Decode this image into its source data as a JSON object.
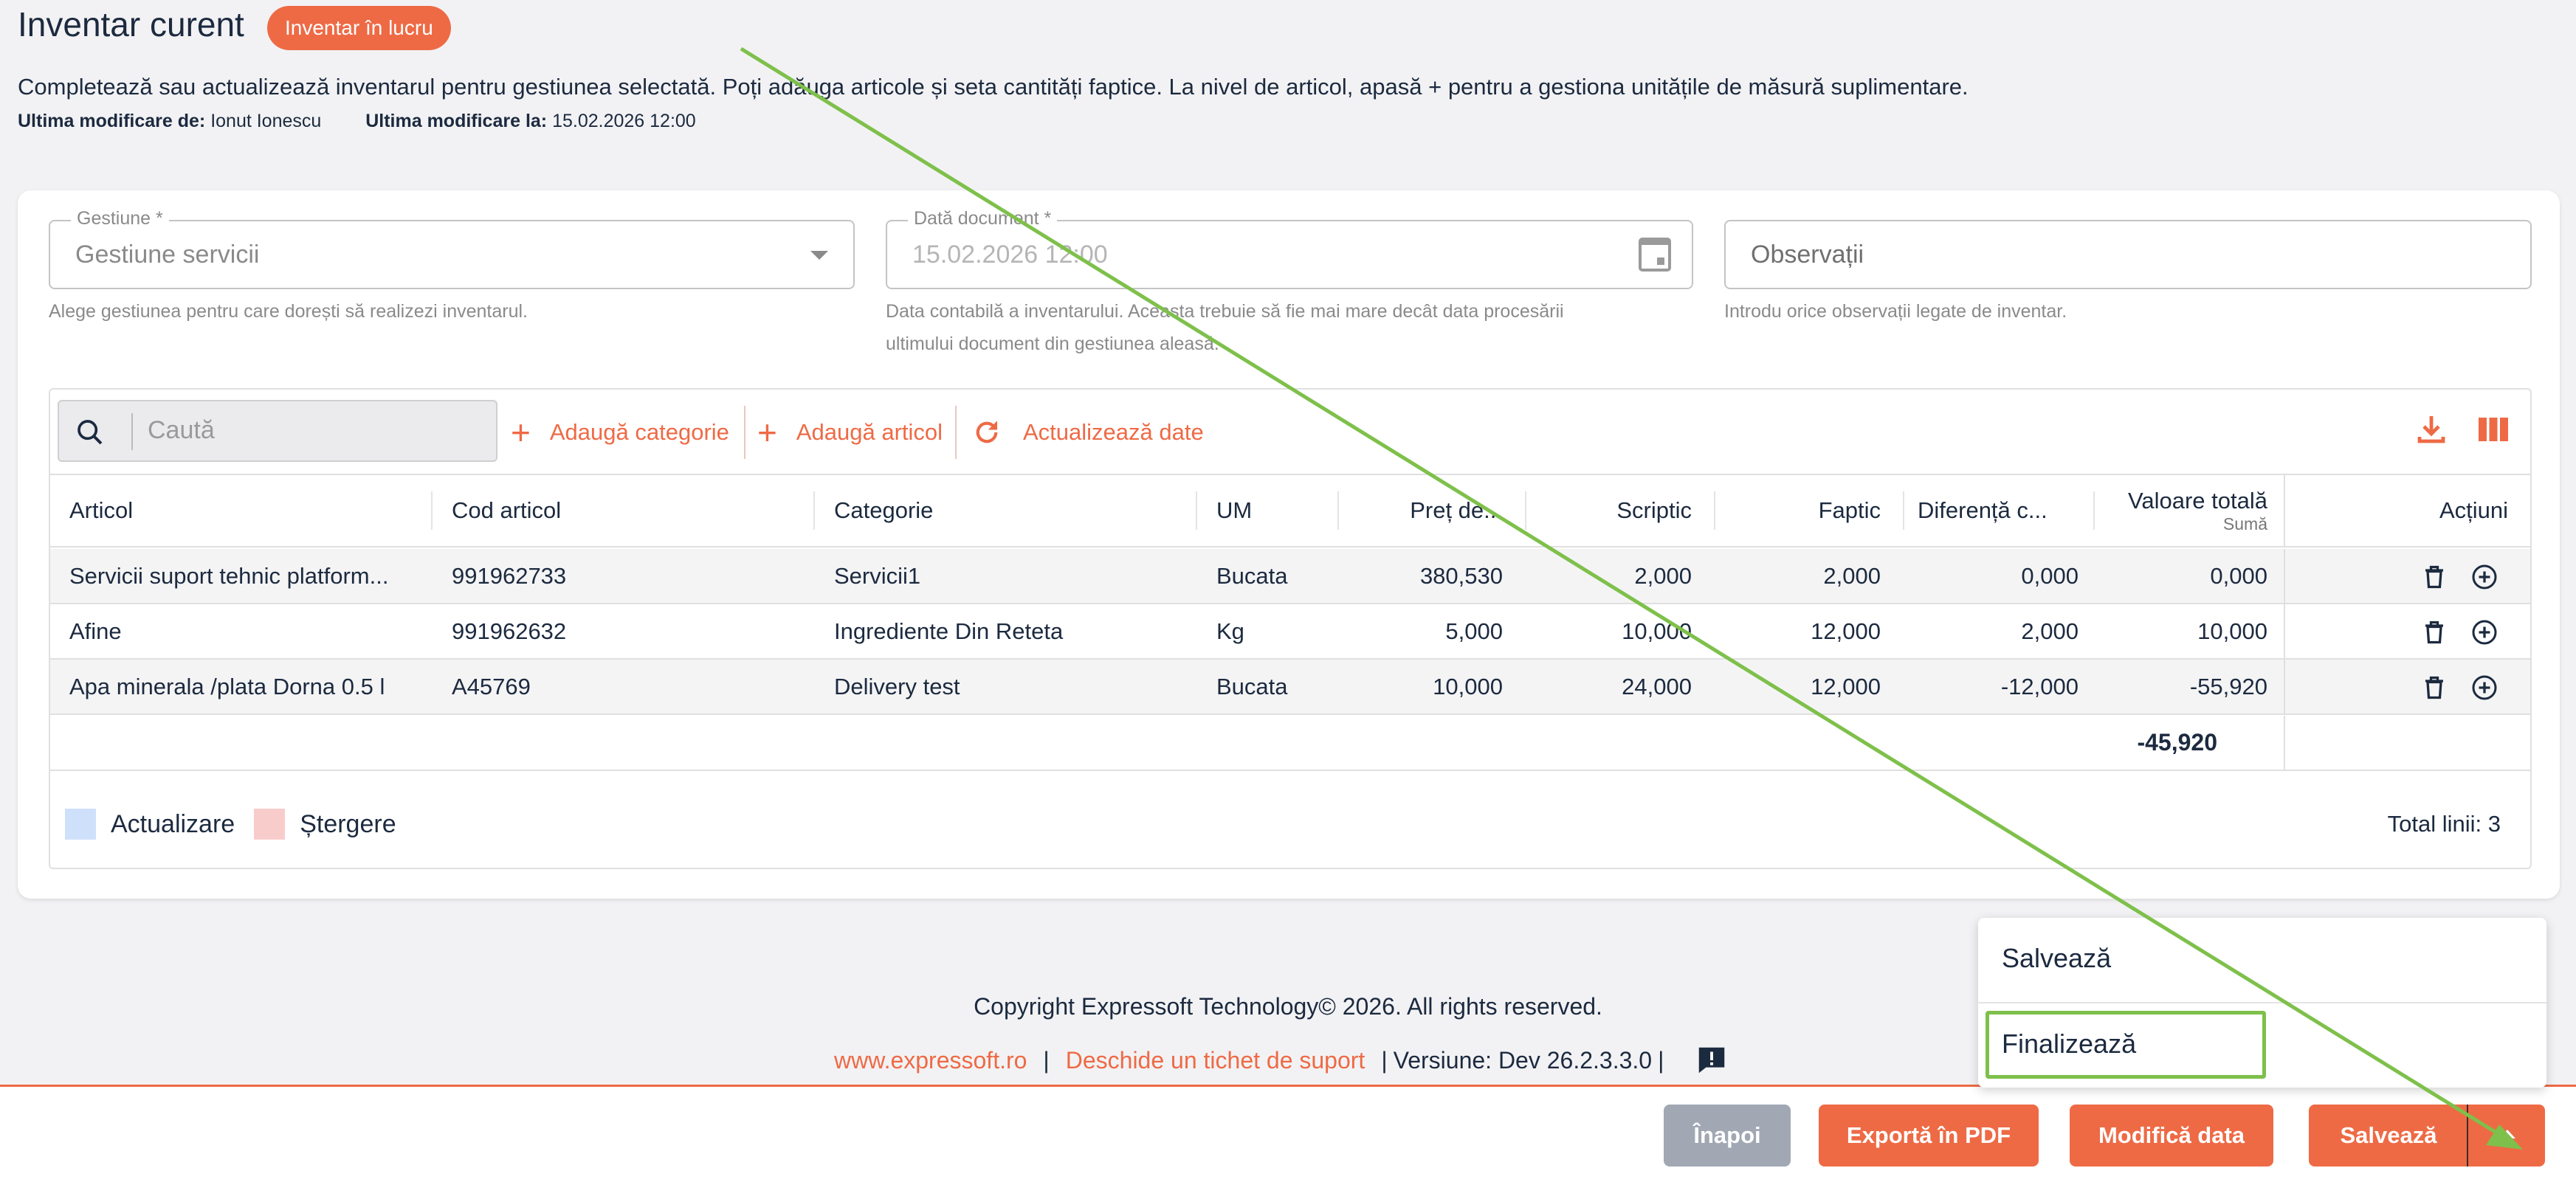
{
  "header": {
    "title": "Inventar curent",
    "status_chip": "Inventar în lucru",
    "description": "Completează sau actualizează inventarul pentru gestiunea selectată. Poți adăuga articole și seta cantități faptice. La nivel de articol, apasă + pentru a gestiona unitățile de măsură suplimentare.",
    "modified_by_label": "Ultima modificare de:",
    "modified_by_value": "Ionut Ionescu",
    "modified_at_label": "Ultima modificare la:",
    "modified_at_value": "15.02.2026 12:00"
  },
  "form": {
    "gestiune": {
      "label": "Gestiune *",
      "value": "Gestiune servicii",
      "help": "Alege gestiunea pentru care dorești să realizezi inventarul."
    },
    "data_document": {
      "label": "Dată document *",
      "value": "15.02.2026 12:00",
      "help_line1": "Data contabilă a inventarului. Aceasta trebuie să fie mai mare decât data procesării",
      "help_line2": "ultimului document din gestiunea aleasă."
    },
    "observatii": {
      "placeholder": "Observații",
      "help": "Introdu orice observații legate de inventar."
    }
  },
  "toolbar": {
    "search_placeholder": "Caută",
    "add_category": "Adaugă categorie",
    "add_article": "Adaugă articol",
    "refresh": "Actualizează date"
  },
  "table": {
    "columns": {
      "articol": "Articol",
      "cod": "Cod articol",
      "categorie": "Categorie",
      "um": "UM",
      "pret": "Preț de...",
      "scriptic": "Scriptic",
      "faptic": "Faptic",
      "diferenta": "Diferență c...",
      "valoare": "Valoare totală",
      "valoare_sub": "Sumă",
      "actiuni": "Acțiuni"
    },
    "rows": [
      {
        "articol": "Servicii suport tehnic platform...",
        "cod": "991962733",
        "categorie": "Servicii1",
        "um": "Bucata",
        "pret": "380,530",
        "scriptic": "2,000",
        "faptic": "2,000",
        "diferenta": "0,000",
        "valoare": "0,000"
      },
      {
        "articol": "Afine",
        "cod": "991962632",
        "categorie": "Ingrediente Din Reteta",
        "um": "Kg",
        "pret": "5,000",
        "scriptic": "10,000",
        "faptic": "12,000",
        "diferenta": "2,000",
        "valoare": "10,000"
      },
      {
        "articol": "Apa minerala /plata Dorna 0.5 l",
        "cod": "A45769",
        "categorie": "Delivery test",
        "um": "Bucata",
        "pret": "10,000",
        "scriptic": "24,000",
        "faptic": "12,000",
        "diferenta": "-12,000",
        "valoare": "-55,920"
      }
    ],
    "total_value": "-45,920"
  },
  "legend": {
    "update_label": "Actualizare",
    "update_color": "#cfe0fb",
    "delete_label": "Ștergere",
    "delete_color": "#f9cccc",
    "total_lines": "Total linii: 3"
  },
  "footer": {
    "copyright": "Copyright Expressoft Technology© 2026. All rights reserved.",
    "website": "www.expressoft.ro",
    "support": "Deschide un tichet de suport",
    "version": "Versiune: Dev 26.2.3.3.0"
  },
  "bottom_buttons": {
    "back": "Înapoi",
    "export_pdf": "Exportă în PDF",
    "change_date": "Modifică data",
    "save": "Salvează"
  },
  "save_menu": {
    "items": [
      "Salvează",
      "Finalizează"
    ]
  },
  "colors": {
    "accent": "#ee6a45",
    "text": "#1c2a3f",
    "annotation": "#7ec04b"
  },
  "icons": [
    "search-icon",
    "plus-icon",
    "refresh-icon",
    "download-icon",
    "columns-icon",
    "calendar-icon",
    "trash-icon",
    "add-circle-icon",
    "feedback-icon",
    "caret-down-icon",
    "caret-up-icon"
  ]
}
